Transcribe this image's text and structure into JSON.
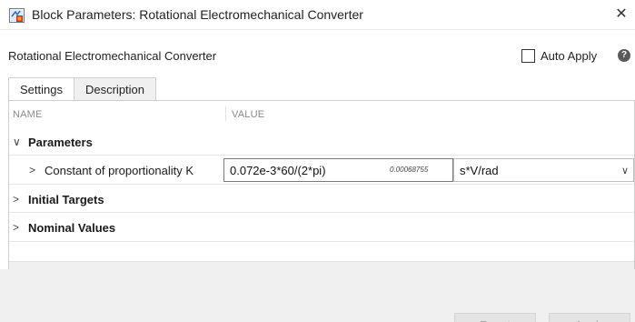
{
  "window": {
    "title": "Block Parameters: Rotational Electromechanical Converter",
    "close_glyph": "✕",
    "icon": "simulink-block-icon"
  },
  "header": {
    "block_name": "Rotational Electromechanical Converter",
    "auto_apply_label": "Auto Apply",
    "auto_apply_checked": false,
    "help_glyph": "?"
  },
  "tabs": [
    {
      "label": "Settings",
      "active": true
    },
    {
      "label": "Description",
      "active": false
    }
  ],
  "table": {
    "columns": {
      "name": "NAME",
      "value": "VALUE"
    },
    "groups": [
      {
        "label": "Parameters",
        "expanded": true,
        "chevron": "∨"
      },
      {
        "label": "Initial Targets",
        "expanded": false,
        "chevron": ">"
      },
      {
        "label": "Nominal Values",
        "expanded": false,
        "chevron": ">"
      }
    ],
    "parameter": {
      "chevron": ">",
      "label": "Constant of proportionality K",
      "expression": "0.072e-3*60/(2*pi)",
      "evaluated": "0.00068755",
      "unit": "s*V/rad",
      "unit_arrow": "∨"
    }
  },
  "buttons": {
    "reset": "Reset",
    "apply": "Apply"
  },
  "colors": {
    "disabled_text": "#a3a3a3",
    "panel_border": "#cfcfcf",
    "footer_bg": "#f0f0f0"
  }
}
